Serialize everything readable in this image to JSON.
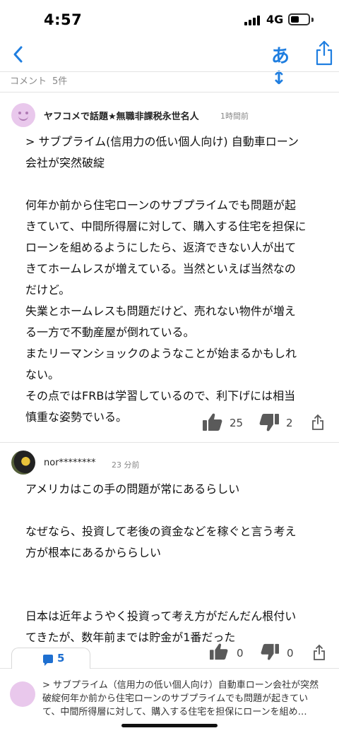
{
  "status": {
    "time": "4:57",
    "network": "4G"
  },
  "nav": {
    "font_size_label": "あ↕"
  },
  "header": {
    "title": "コメント",
    "count": "5件"
  },
  "comments": [
    {
      "user": "ヤフコメで話題★無職非課税永世名人",
      "time": "1時間前",
      "lines": [
        "> サブプライム(信用力の低い個人向け) 自動車ローン",
        "会社が突然破綻",
        "",
        "何年か前から住宅ローンのサブプライムでも問題が起",
        "きていて、中間所得層に対して、購入する住宅を担保に",
        "ローンを組めるようにしたら、返済できない人が出て",
        "きてホームレスが増えている。当然といえば当然なの",
        "だけど。",
        "失業とホームレスも問題だけど、売れない物件が増え",
        "る一方で不動産屋が倒れている。",
        "またリーマンショックのようなことが始まるかもしれ",
        "ない。",
        "その点ではFRBは学習しているので、利下げには相当",
        "慎重な姿勢でいる。"
      ],
      "likes": "25",
      "dislikes": "2"
    },
    {
      "user": "nor********",
      "time": "23 分前",
      "lines": [
        "アメリカはこの手の問題が常にあるらしい",
        "",
        "なぜなら、投資して老後の資金などを稼ぐと言う考え",
        "方が根本にあるかららしい",
        "",
        "",
        "日本は近年ようやく投資って考え方がだんだん根付い",
        "てきたが、数年前までは貯金が1番だった"
      ],
      "likes": "0",
      "dislikes": "0"
    }
  ],
  "bottom": {
    "comment_count": "5",
    "preview_line1": "> サブプライム（信用力の低い個人向け）自動車ローン会社が突然",
    "preview_line2": "破綻何年か前から住宅ローンのサブプライムでも問題が起きてい",
    "preview_line3": "て、中間所得層に対して、購入する住宅を担保にローンを組め…"
  },
  "colors": {
    "accent": "#1f7ee0",
    "icon_gray": "#5a5a5a",
    "avatar_pink": "#e9c8ec"
  }
}
